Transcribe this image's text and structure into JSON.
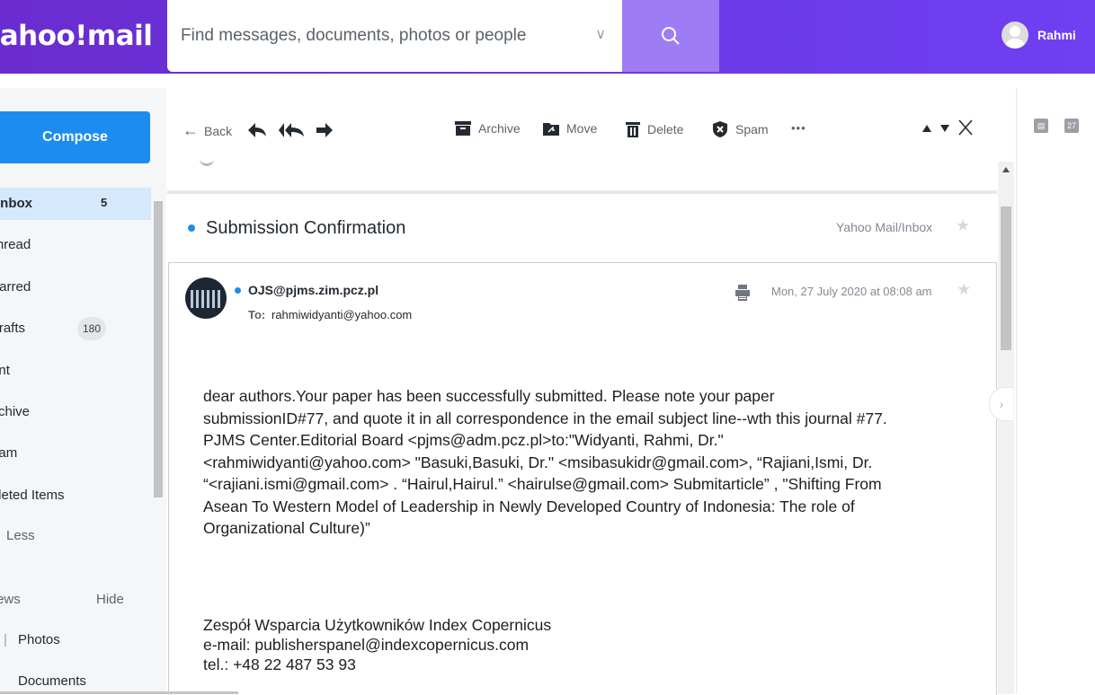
{
  "app": {
    "logo_text": "yahoo!mail"
  },
  "search": {
    "placeholder": "Find messages, documents, photos or people"
  },
  "user": {
    "name": "Rahmi"
  },
  "sidebar": {
    "compose_label": "Compose",
    "folders": [
      {
        "label": "Inbox",
        "count": "5"
      },
      {
        "label": "Unread"
      },
      {
        "label": "Starred"
      },
      {
        "label": "Drafts",
        "count": "180"
      },
      {
        "label": "Sent"
      },
      {
        "label": "Archive"
      },
      {
        "label": "Spam"
      },
      {
        "label": "Deleted Items"
      },
      {
        "label": "Less"
      }
    ],
    "views_label": "Views",
    "hide_label": "Hide",
    "views": [
      {
        "label": "Photos"
      },
      {
        "label": "Documents"
      }
    ]
  },
  "toolbar": {
    "back": "Back",
    "archive": "Archive",
    "move": "Move",
    "delete": "Delete",
    "spam": "Spam",
    "more": "•••"
  },
  "thread": {
    "subject": "Submission Confirmation",
    "folder_path": "Yahoo Mail/Inbox"
  },
  "message": {
    "sender": "OJS@pjms.zim.pcz.pl",
    "to_label": "To:",
    "to": "rahmiwidyanti@yahoo.com",
    "date": "Mon, 27 July 2020 at 08:08 am",
    "body": [
      "dear authors.Your paper has been successfully submitted. Please note your paper",
      "submissionID#77, and quote it in all correspondence in the email subject line--wth this journal #77.",
      "PJMS Center.Editorial Board <pjms@adm.pcz.pl>to:\"Widyanti, Rahmi, Dr.\"",
      "<rahmiwidyanti@yahoo.com> \"Basuki,Basuki, Dr.\" <msibasukidr@gmail.com>, “Rajiani,Ismi, Dr.",
      "“<rajiani.ismi@gmail.com> . “Hairul,Hairul.” <hairulse@gmail.com> Submitarticle” , \"Shifting From",
      "Asean To Western Model of Leadership in Newly Developed Country of Indonesia: The role of",
      "Organizational Culture)”"
    ],
    "signature": [
      "Zespół Wsparcia Użytkowników Index Copernicus",
      "e-mail: publisherspanel@indexcopernicus.com",
      "tel.: +48 22 487 53 93"
    ]
  },
  "right_panel": {
    "calendar_day": "27"
  }
}
